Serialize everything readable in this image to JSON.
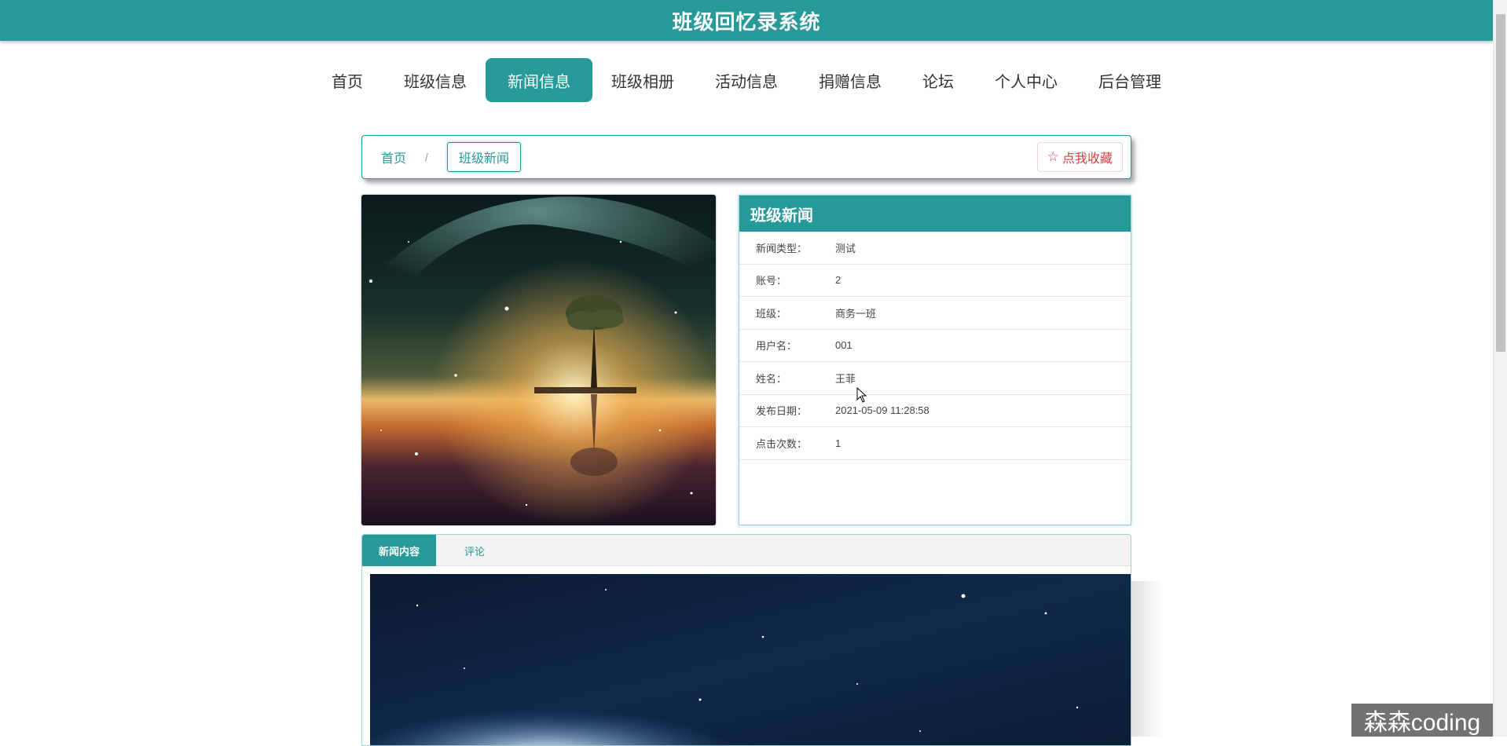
{
  "header": {
    "title": "班级回忆录系统"
  },
  "nav": {
    "items": [
      {
        "label": "首页",
        "active": false
      },
      {
        "label": "班级信息",
        "active": false
      },
      {
        "label": "新闻信息",
        "active": true
      },
      {
        "label": "班级相册",
        "active": false
      },
      {
        "label": "活动信息",
        "active": false
      },
      {
        "label": "捐赠信息",
        "active": false
      },
      {
        "label": "论坛",
        "active": false
      },
      {
        "label": "个人中心",
        "active": false
      },
      {
        "label": "后台管理",
        "active": false
      }
    ]
  },
  "breadcrumb": {
    "home": "首页",
    "separator": "/",
    "current": "班级新闻",
    "favorite_label": "点我收藏",
    "favorite_icon": "star-outline-icon"
  },
  "info": {
    "title": "班级新闻",
    "rows": [
      {
        "label": "新闻类型：",
        "value": "测试"
      },
      {
        "label": "账号：",
        "value": "2"
      },
      {
        "label": "班级：",
        "value": "商务一班"
      },
      {
        "label": "用户名：",
        "value": "001"
      },
      {
        "label": "姓名：",
        "value": "王菲"
      },
      {
        "label": "发布日期：",
        "value": "2021-05-09 11:28:58"
      },
      {
        "label": "点击次数：",
        "value": "1"
      }
    ]
  },
  "tabs": [
    {
      "label": "新闻内容",
      "active": true
    },
    {
      "label": "评论",
      "active": false
    }
  ],
  "watermark": "森森coding",
  "colors": {
    "primary": "#259a99",
    "favorite": "#d93f3f"
  }
}
